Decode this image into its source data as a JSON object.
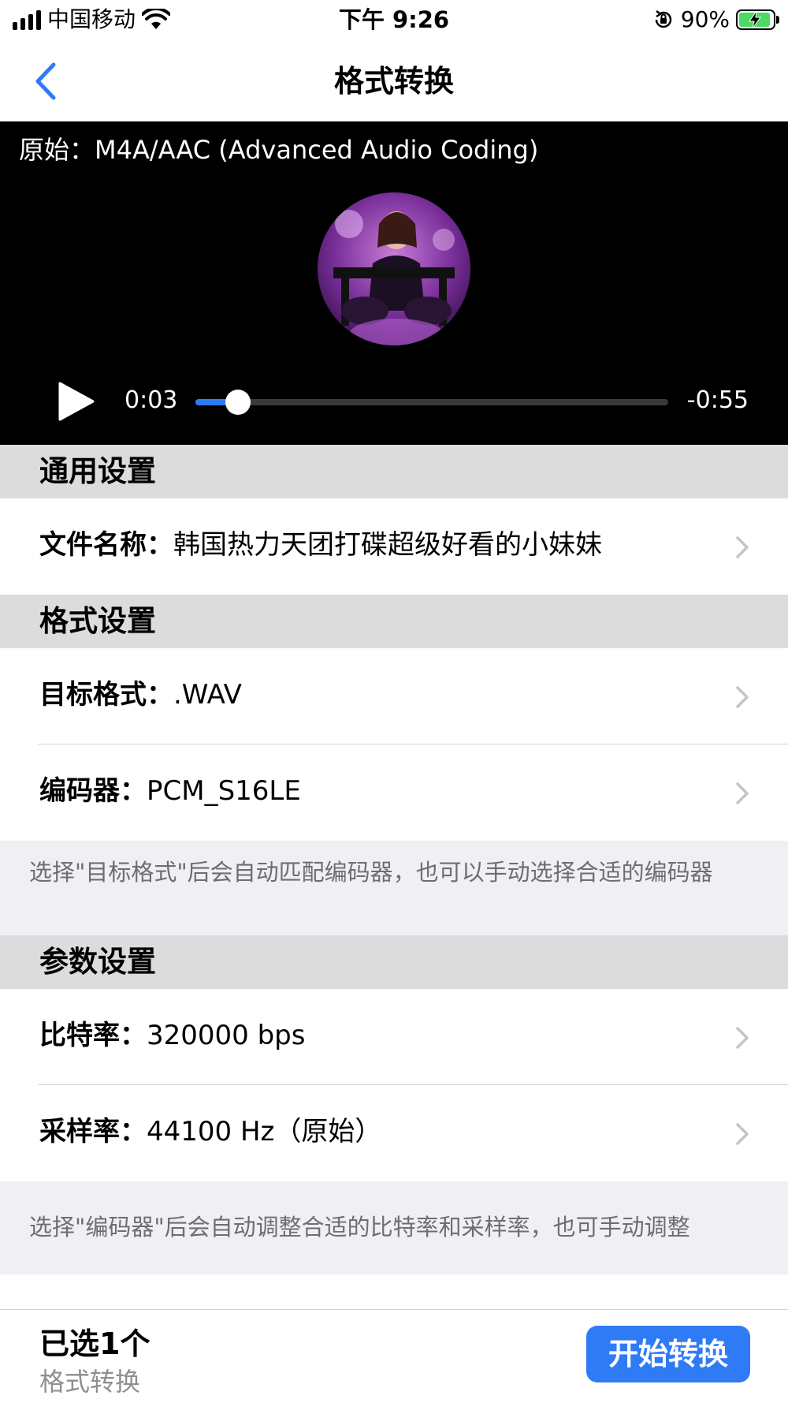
{
  "status_bar": {
    "carrier": "中国移动",
    "time": "下午 9:26",
    "battery_percent": "90%",
    "icons": [
      "signal-icon",
      "wifi-icon",
      "rotation-lock-icon",
      "battery-charging-icon"
    ]
  },
  "nav": {
    "title": "格式转换",
    "back_icon": "chevron-left-icon"
  },
  "player": {
    "original_label": "原始：M4A/AAC (Advanced Audio Coding)",
    "current_time": "0:03",
    "remaining_time": "-0:55",
    "progress_fraction": 0.09,
    "play_icon": "play-icon"
  },
  "sections": {
    "general": {
      "header": "通用设置",
      "file_name_label": "文件名称：",
      "file_name_value": "韩国热力天团打碟超级好看的小妹妹"
    },
    "format": {
      "header": "格式设置",
      "target_label": "目标格式：",
      "target_value": ".WAV",
      "encoder_label": "编码器：",
      "encoder_value": "PCM_S16LE",
      "note": "选择\"目标格式\"后会自动匹配编码器，也可以手动选择合适的编码器"
    },
    "params": {
      "header": "参数设置",
      "bitrate_label": "比特率：",
      "bitrate_value": "320000 bps",
      "samplerate_label": "采样率：",
      "samplerate_value": "44100 Hz（原始）",
      "note": "选择\"编码器\"后会自动调整合适的比特率和采样率，也可手动调整"
    }
  },
  "bottom": {
    "selected": "已选1个",
    "subtitle": "格式转换",
    "start_button": "开始转换"
  },
  "colors": {
    "accent": "#2f7bf6",
    "section_header_bg": "#dcdcdc",
    "note_bg": "#efeff4",
    "player_bg": "#000000"
  }
}
